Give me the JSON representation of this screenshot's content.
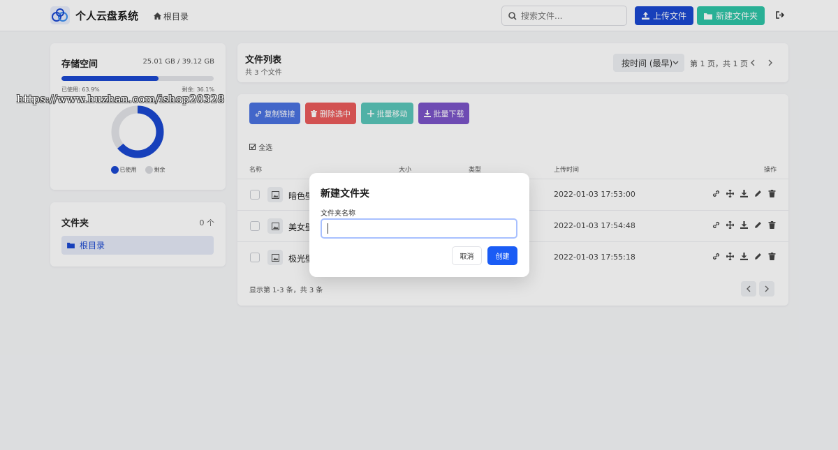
{
  "header": {
    "app_title": "个人云盘系统",
    "root_link": "根目录",
    "search_placeholder": "搜索文件...",
    "upload_label": "上传文件",
    "new_folder_label": "新建文件夹"
  },
  "storage": {
    "title": "存储空间",
    "amount": "25.01 GB / 39.12 GB",
    "used_percent": 63.9,
    "used_text": "已使用: 63.9%",
    "remain_text": "剩余: 36.1%",
    "legend_used": "已使用",
    "legend_remain": "剩余"
  },
  "folders": {
    "title": "文件夹",
    "count": "0 个",
    "items": [
      {
        "label": "根目录"
      }
    ]
  },
  "file_list": {
    "title": "文件列表",
    "subtitle": "共 3 个文件",
    "sort_value": "按时间 (最早)",
    "page_info": "第 1 页，共 1 页",
    "actions": {
      "copy": "复制链接",
      "delete": "删除选中",
      "move": "批量移动",
      "download": "批量下载"
    },
    "select_all": "全选",
    "columns": [
      "名称",
      "大小",
      "类型",
      "上传时间",
      "操作"
    ],
    "rows": [
      {
        "name": "暗色壁",
        "time": "2022-01-03 17:53:00"
      },
      {
        "name": "美女壁",
        "time": "2022-01-03 17:54:48"
      },
      {
        "name": "极光壁",
        "time": "2022-01-03 17:55:18"
      }
    ],
    "footer": "显示第 1-3 条，共 3 条"
  },
  "modal": {
    "title": "新建文件夹",
    "field_label": "文件夹名称",
    "field_value": "",
    "cancel": "取消",
    "create": "创建"
  },
  "watermark": "https://www.huzhan.com/ishop20328",
  "colors": {
    "primary": "#1a48d1",
    "teal": "#2ec4a6",
    "danger": "#ea5b5b",
    "purple": "#7b54c8",
    "remaining": "#e2e4e8"
  }
}
